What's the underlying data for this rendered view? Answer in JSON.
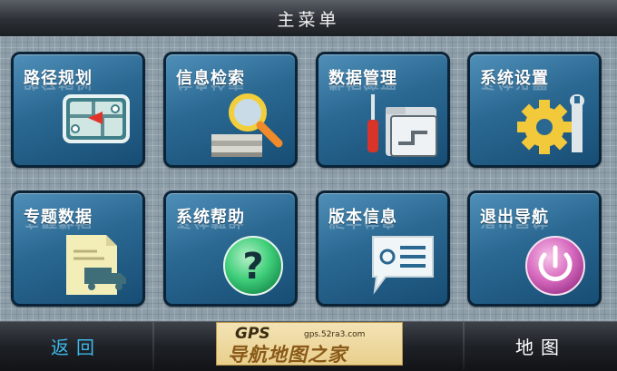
{
  "header": {
    "title": "主菜单"
  },
  "tiles": [
    {
      "label": "路径规划",
      "icon": "route-planning-icon"
    },
    {
      "label": "信息检索",
      "icon": "magnifier-search-icon"
    },
    {
      "label": "数据管理",
      "icon": "folder-screwdriver-icon"
    },
    {
      "label": "系统设置",
      "icon": "gear-wrench-icon"
    },
    {
      "label": "专题数据",
      "icon": "document-truck-icon"
    },
    {
      "label": "系统帮助",
      "icon": "help-question-icon"
    },
    {
      "label": "版本信息",
      "icon": "info-card-icon"
    },
    {
      "label": "退出导航",
      "icon": "power-icon"
    }
  ],
  "footer": {
    "back_label": "返回",
    "map_label": "地图",
    "watermark_gps": "GPS",
    "watermark_url": "gps.52ra3.com",
    "watermark_text": "导航地图之家"
  },
  "colors": {
    "tile_blue": "#2a6892",
    "tile_border": "#0b2336",
    "accent_orange": "#f08a2a"
  }
}
